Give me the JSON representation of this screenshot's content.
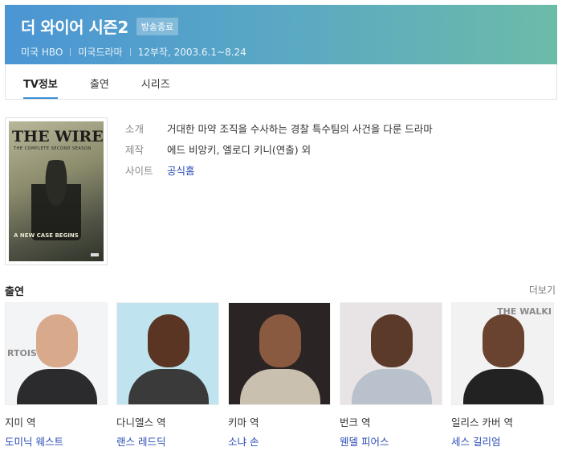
{
  "header": {
    "title": "더 와이어 시즌2",
    "status": "방송종료",
    "meta": [
      "미국 HBO",
      "미국드라마",
      "12부작, 2003.6.1~8.24"
    ]
  },
  "tabs": [
    {
      "label": "TV정보",
      "active": true
    },
    {
      "label": "출연",
      "active": false
    },
    {
      "label": "시리즈",
      "active": false
    }
  ],
  "poster": {
    "title": "THE WIRE",
    "subtitle": "THE COMPLETE SECOND SEASON",
    "tagline": "A NEW CASE BEGINS"
  },
  "info": {
    "intro_label": "소개",
    "intro_value": "거대한 마약 조직을 수사하는 경찰 특수팀의 사건을 다룬 드라마",
    "production_label": "제작",
    "production_value": "에드 비앙키, 엘로디 키니(연출) 외",
    "site_label": "사이트",
    "site_value": "공식홈"
  },
  "cast_section": {
    "title": "출연",
    "more": "더보기",
    "items": [
      {
        "role": "지미 역",
        "actor": "도미닉 웨스트",
        "photo_text": "RTOIS",
        "bg": "#f3f4f6",
        "skin": "#d9a98c",
        "shirt": "#2b2b2e"
      },
      {
        "role": "다니엘스 역",
        "actor": "랜스 레드딕",
        "photo_text": "",
        "bg": "#bfe4ef",
        "skin": "#5a3524",
        "shirt": "#3a3a3a"
      },
      {
        "role": "키마 역",
        "actor": "소냐 손",
        "photo_text": "",
        "bg": "#2a2424",
        "skin": "#8a5a40",
        "shirt": "#c9c0b0"
      },
      {
        "role": "번크 역",
        "actor": "웬델 피어스",
        "photo_text": "",
        "bg": "#e8e4e6",
        "skin": "#5b3a2a",
        "shirt": "#b9c2cc"
      },
      {
        "role": "일리스 카버 역",
        "actor": "세스 길리엄",
        "photo_text": "THE WALKI",
        "bg": "#f2f2f2",
        "skin": "#6a4330",
        "shirt": "#222222"
      }
    ]
  }
}
